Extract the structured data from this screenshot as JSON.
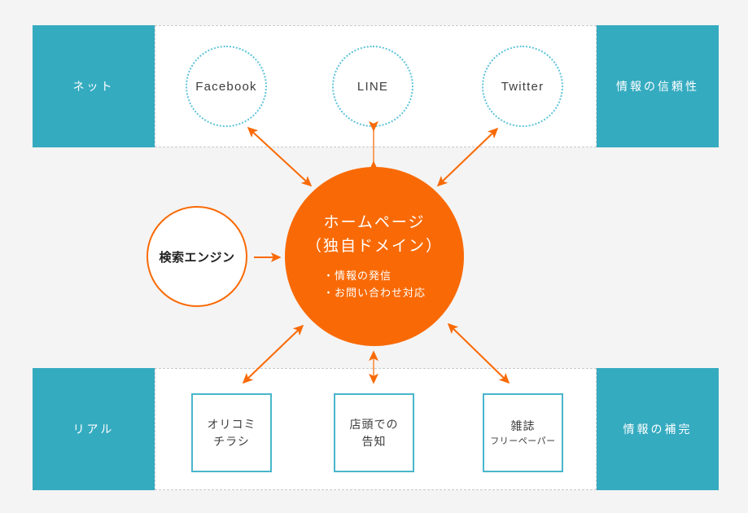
{
  "diagram": {
    "background_color": "#f4f4f4",
    "accent_orange": "#f96a06",
    "accent_teal": "#35abc0",
    "box_teal": "#49b6cc",
    "dotted_blue": "#5cc3da"
  },
  "bands": {
    "top": {
      "left_label": "ネット",
      "right_label": "情報の信頼性",
      "nodes": [
        {
          "label": "Facebook"
        },
        {
          "label": "LINE"
        },
        {
          "label": "Twitter"
        }
      ]
    },
    "bottom": {
      "left_label": "リアル",
      "right_label": "情報の補完",
      "nodes": [
        {
          "line1": "オリコミ",
          "line2": "チラシ"
        },
        {
          "line1": "店頭での",
          "line2": "告知"
        },
        {
          "line1": "雑誌",
          "line2": "フリーペーパー"
        }
      ]
    }
  },
  "hub": {
    "title_line1": "ホームページ",
    "title_line2": "（独自ドメイン）",
    "bullet1": "・情報の発信",
    "bullet2": "・お問い合わせ対応"
  },
  "search": {
    "label": "検索エンジン"
  },
  "connections": [
    {
      "name": "hub-facebook",
      "type": "double"
    },
    {
      "name": "hub-line",
      "type": "double"
    },
    {
      "name": "hub-twitter",
      "type": "double"
    },
    {
      "name": "search-hub",
      "type": "single"
    },
    {
      "name": "hub-orikomi",
      "type": "double"
    },
    {
      "name": "hub-tento",
      "type": "double"
    },
    {
      "name": "hub-zasshi",
      "type": "double"
    }
  ]
}
